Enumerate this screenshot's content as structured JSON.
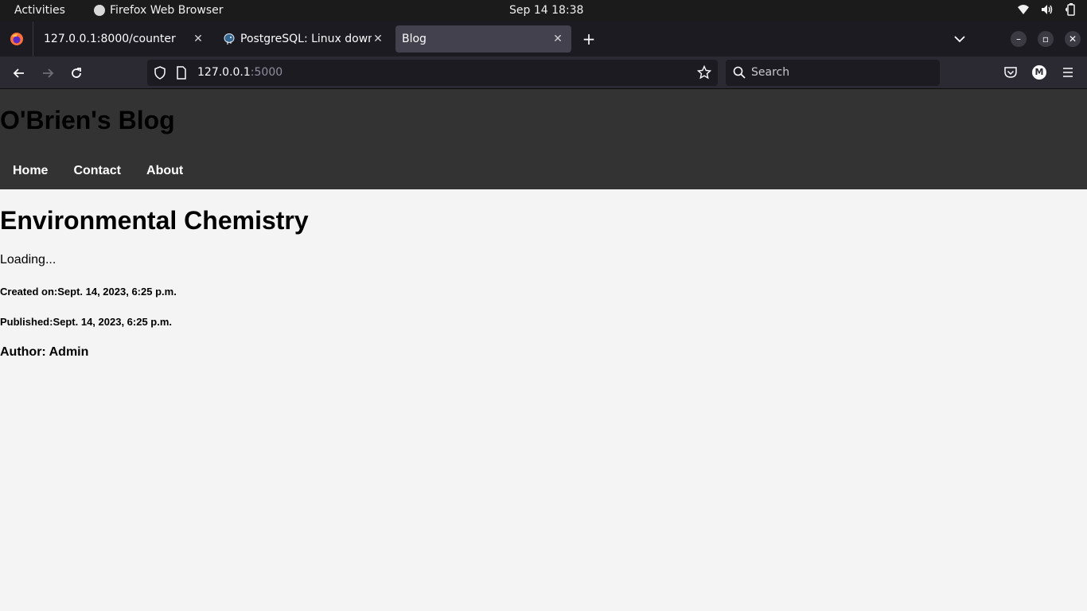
{
  "topbar": {
    "activities": "Activities",
    "app_name": "Firefox Web Browser",
    "clock": "Sep 14  18:38"
  },
  "tabs": [
    {
      "title": "127.0.0.1:8000/counter",
      "active": false
    },
    {
      "title": "PostgreSQL: Linux downloads",
      "active": false
    },
    {
      "title": "Blog",
      "active": true
    }
  ],
  "urlbar": {
    "host": "127.0.0.1",
    "port": ":5000"
  },
  "searchbar": {
    "placeholder": "Search"
  },
  "account": {
    "initial": "M"
  },
  "site": {
    "title": "O'Brien's Blog",
    "nav": [
      "Home",
      "Contact",
      "About"
    ]
  },
  "post": {
    "title": "Environmental Chemistry",
    "body": "Loading...",
    "created": "Created on:Sept. 14, 2023, 6:25 p.m.",
    "published": "Published:Sept. 14, 2023, 6:25 p.m.",
    "author": "Author: Admin"
  },
  "colors": {
    "header_bg": "#333333",
    "page_bg": "#f4f4f4",
    "nav_text": "#ffffff"
  }
}
